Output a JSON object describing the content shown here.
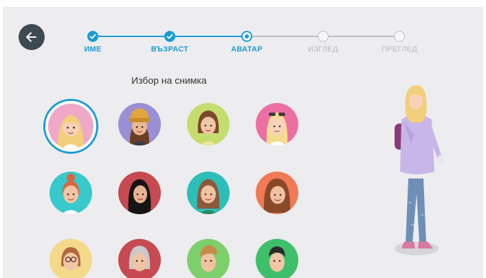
{
  "steps": [
    {
      "label": "ИМЕ",
      "state": "done"
    },
    {
      "label": "ВЪЗРАСТ",
      "state": "done"
    },
    {
      "label": "АВАТАР",
      "state": "current"
    },
    {
      "label": "ИЗГЛЕД",
      "state": "todo"
    },
    {
      "label": "ПРЕГЛЕД",
      "state": "todo"
    }
  ],
  "section_title": "Избор на снимка",
  "avatars": [
    {
      "name": "avatar-blonde-girl",
      "bg": "#f0a8c8",
      "selected": true
    },
    {
      "name": "avatar-beanie-girl",
      "bg": "#9b8fd4",
      "selected": false
    },
    {
      "name": "avatar-bob-hair-girl",
      "bg": "#c5dd6e",
      "selected": false
    },
    {
      "name": "avatar-sunglasses-girl",
      "bg": "#ec6fa3",
      "selected": false
    },
    {
      "name": "avatar-redhead-bun-girl",
      "bg": "#38c9cc",
      "selected": false
    },
    {
      "name": "avatar-black-hair-girl",
      "bg": "#c74a52",
      "selected": false
    },
    {
      "name": "avatar-brown-hair-woman",
      "bg": "#2bbfb8",
      "selected": false
    },
    {
      "name": "avatar-curly-hair-woman",
      "bg": "#f07a55",
      "selected": false
    },
    {
      "name": "avatar-glasses-woman",
      "bg": "#f5d98a",
      "selected": false
    },
    {
      "name": "avatar-grey-hair-woman",
      "bg": "#c74a52",
      "selected": false
    },
    {
      "name": "avatar-young-man",
      "bg": "#7ccf6a",
      "selected": false
    },
    {
      "name": "avatar-dark-hair-man",
      "bg": "#3fbf6b",
      "selected": false
    }
  ],
  "colors": {
    "accent": "#1a9bd6",
    "inactive": "#b5babe",
    "back_button": "#3d4a52",
    "background": "#ededef"
  },
  "icons": {
    "back": "arrow-left-icon",
    "step_done": "check-icon"
  }
}
